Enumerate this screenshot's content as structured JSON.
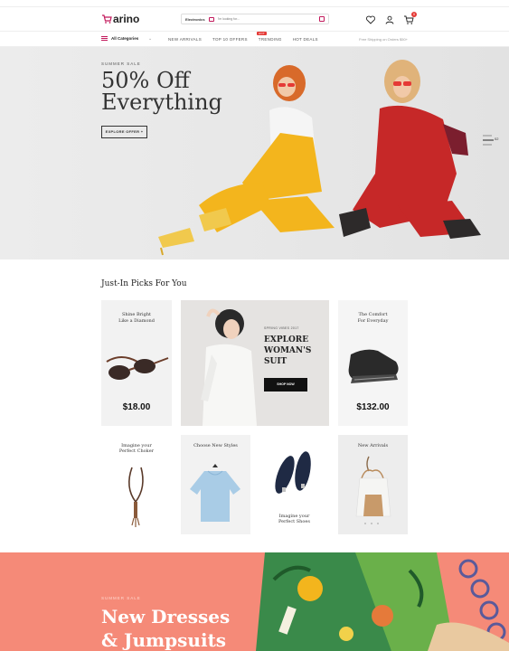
{
  "header": {
    "logo_text": "arino",
    "search_category": "Electronics",
    "search_placeholder": "I'm looking for...",
    "cart_count": "0"
  },
  "nav": {
    "all_categories": "All Categories",
    "links": [
      "NEW ARRIVALS",
      "TOP 10 OFFERS",
      "TRENDING",
      "HOT DEALS"
    ],
    "hot_badge": "HOT",
    "free_shipping": "Free Shipping on Orders $50+"
  },
  "hero": {
    "subtitle": "SUMMER SALE",
    "title_line1": "50% Off",
    "title_line2": "Everything",
    "button": "EXPLORE OFFER +",
    "slide_number": "02"
  },
  "picks": {
    "section_title": "Just-In Picks For You",
    "card1": {
      "title_line1": "Shine Bright",
      "title_line2": "Like a Diamond",
      "price": "$18.00"
    },
    "promo": {
      "tag": "SPRING VIBES 2017",
      "title_line1": "EXPLORE",
      "title_line2": "WOMAN'S",
      "title_line3": "SUIT",
      "button": "SHOP NOW"
    },
    "card3": {
      "title_line1": "The Comfort",
      "title_line2": "For Everyday",
      "price": "$132.00"
    },
    "card4": {
      "title_line1": "Imagine your",
      "title_line2": "Perfect Choker"
    },
    "card5": {
      "title_line1": "Choose New Styles"
    },
    "card6": {
      "title_line1": "Imagine your",
      "title_line2": "Perfect Shoes"
    },
    "card7": {
      "title_line1": "New Arrivals"
    }
  },
  "banner": {
    "subtitle": "SUMMER SALE",
    "title_line1": "New Dresses",
    "title_line2": "& Jumpsuits"
  },
  "colors": {
    "brand": "#c2185b",
    "badge": "#e53935",
    "banner_bg": "#f58a78"
  }
}
